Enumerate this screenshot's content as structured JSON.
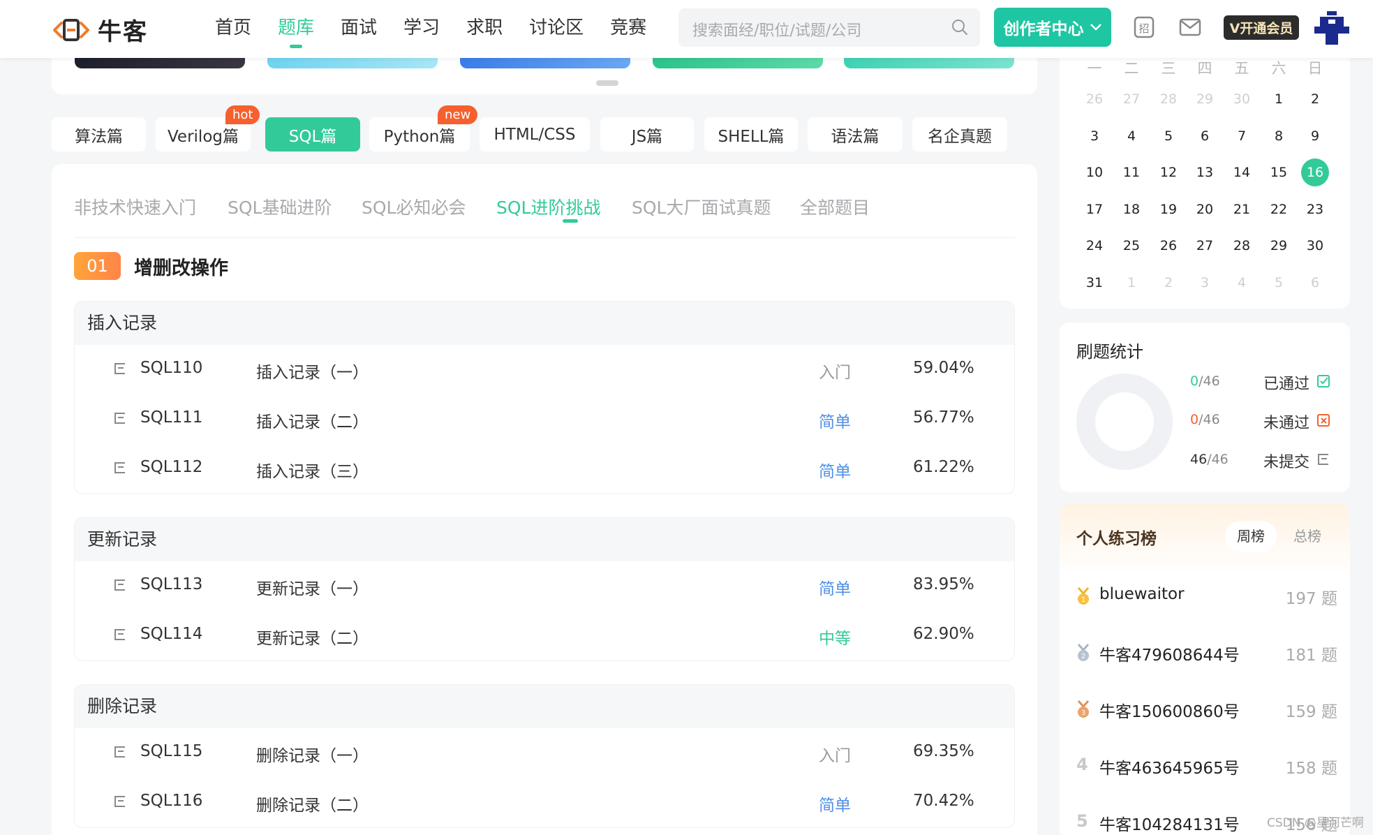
{
  "header": {
    "logo_text": "牛客",
    "nav": [
      "首页",
      "题库",
      "面试",
      "学习",
      "求职",
      "讨论区",
      "竞赛"
    ],
    "nav_active": "题库",
    "search_placeholder": "搜索面经/职位/试题/公司",
    "creator_label": "创作者中心",
    "vip_label": "V开通会员",
    "icons": [
      "search-icon",
      "chevron-down-icon",
      "recruit-icon",
      "mail-icon",
      "avatar"
    ],
    "accent": "#32ca99"
  },
  "categories": [
    {
      "label": "算法篇",
      "badge": ""
    },
    {
      "label": "Verilog篇",
      "badge": "hot"
    },
    {
      "label": "SQL篇",
      "badge": "",
      "active": true
    },
    {
      "label": "Python篇",
      "badge": "new"
    },
    {
      "label": "HTML/CSS",
      "badge": ""
    },
    {
      "label": "JS篇",
      "badge": ""
    },
    {
      "label": "SHELL篇",
      "badge": ""
    },
    {
      "label": "语法篇",
      "badge": ""
    },
    {
      "label": "名企真题",
      "badge": ""
    }
  ],
  "subtabs": [
    "非技术快速入门",
    "SQL基础进阶",
    "SQL必知必会",
    "SQL进阶挑战",
    "SQL大厂面试真题",
    "全部题目"
  ],
  "subtab_active": "SQL进阶挑战",
  "section": {
    "number": "01",
    "title": "增删改操作"
  },
  "groups": [
    {
      "title": "插入记录",
      "rows": [
        {
          "id": "SQL110",
          "title": "插入记录（一）",
          "level": "入门",
          "level_type": "intro",
          "rate": "59.04%"
        },
        {
          "id": "SQL111",
          "title": "插入记录（二）",
          "level": "简单",
          "level_type": "easy",
          "rate": "56.77%"
        },
        {
          "id": "SQL112",
          "title": "插入记录（三）",
          "level": "简单",
          "level_type": "easy",
          "rate": "61.22%"
        }
      ]
    },
    {
      "title": "更新记录",
      "rows": [
        {
          "id": "SQL113",
          "title": "更新记录（一）",
          "level": "简单",
          "level_type": "easy",
          "rate": "83.95%"
        },
        {
          "id": "SQL114",
          "title": "更新记录（二）",
          "level": "中等",
          "level_type": "mid",
          "rate": "62.90%"
        }
      ]
    },
    {
      "title": "删除记录",
      "rows": [
        {
          "id": "SQL115",
          "title": "删除记录（一）",
          "level": "入门",
          "level_type": "intro",
          "rate": "69.35%"
        },
        {
          "id": "SQL116",
          "title": "删除记录（二）",
          "level": "简单",
          "level_type": "easy",
          "rate": "70.42%"
        }
      ]
    }
  ],
  "calendar": {
    "weekdays": [
      "一",
      "二",
      "三",
      "四",
      "五",
      "六",
      "日"
    ],
    "weeks": [
      [
        "26",
        "27",
        "28",
        "29",
        "30",
        "1",
        "2"
      ],
      [
        "3",
        "4",
        "5",
        "6",
        "7",
        "8",
        "9"
      ],
      [
        "10",
        "11",
        "12",
        "13",
        "14",
        "15",
        "16"
      ],
      [
        "17",
        "18",
        "19",
        "20",
        "21",
        "22",
        "23"
      ],
      [
        "24",
        "25",
        "26",
        "27",
        "28",
        "29",
        "30"
      ],
      [
        "31",
        "1",
        "2",
        "3",
        "4",
        "5",
        "6"
      ]
    ],
    "today": "16"
  },
  "stats": {
    "title": "刷题统计",
    "items": [
      {
        "done": "0",
        "total": "/46",
        "label": "已通过",
        "color": "#32ca99"
      },
      {
        "done": "0",
        "total": "/46",
        "label": "未通过",
        "color": "#f5602e"
      },
      {
        "done": "46",
        "total": "/46",
        "label": "未提交",
        "color": "#333333"
      }
    ]
  },
  "ranking": {
    "title": "个人练习榜",
    "tabs": [
      "周榜",
      "总榜"
    ],
    "tab_active": "周榜",
    "items": [
      {
        "rank": "1",
        "name": "bluewaitor",
        "count": "197",
        "unit": "题"
      },
      {
        "rank": "2",
        "name": "牛客479608644号",
        "count": "181",
        "unit": "题"
      },
      {
        "rank": "3",
        "name": "牛客150600860号",
        "count": "159",
        "unit": "题"
      },
      {
        "rank": "4",
        "name": "牛客463645965号",
        "count": "158",
        "unit": "题"
      },
      {
        "rank": "5",
        "name": "牛客104284131号",
        "count": "156",
        "unit": "题"
      }
    ]
  },
  "watermark": "CSDN @星河芒啊"
}
